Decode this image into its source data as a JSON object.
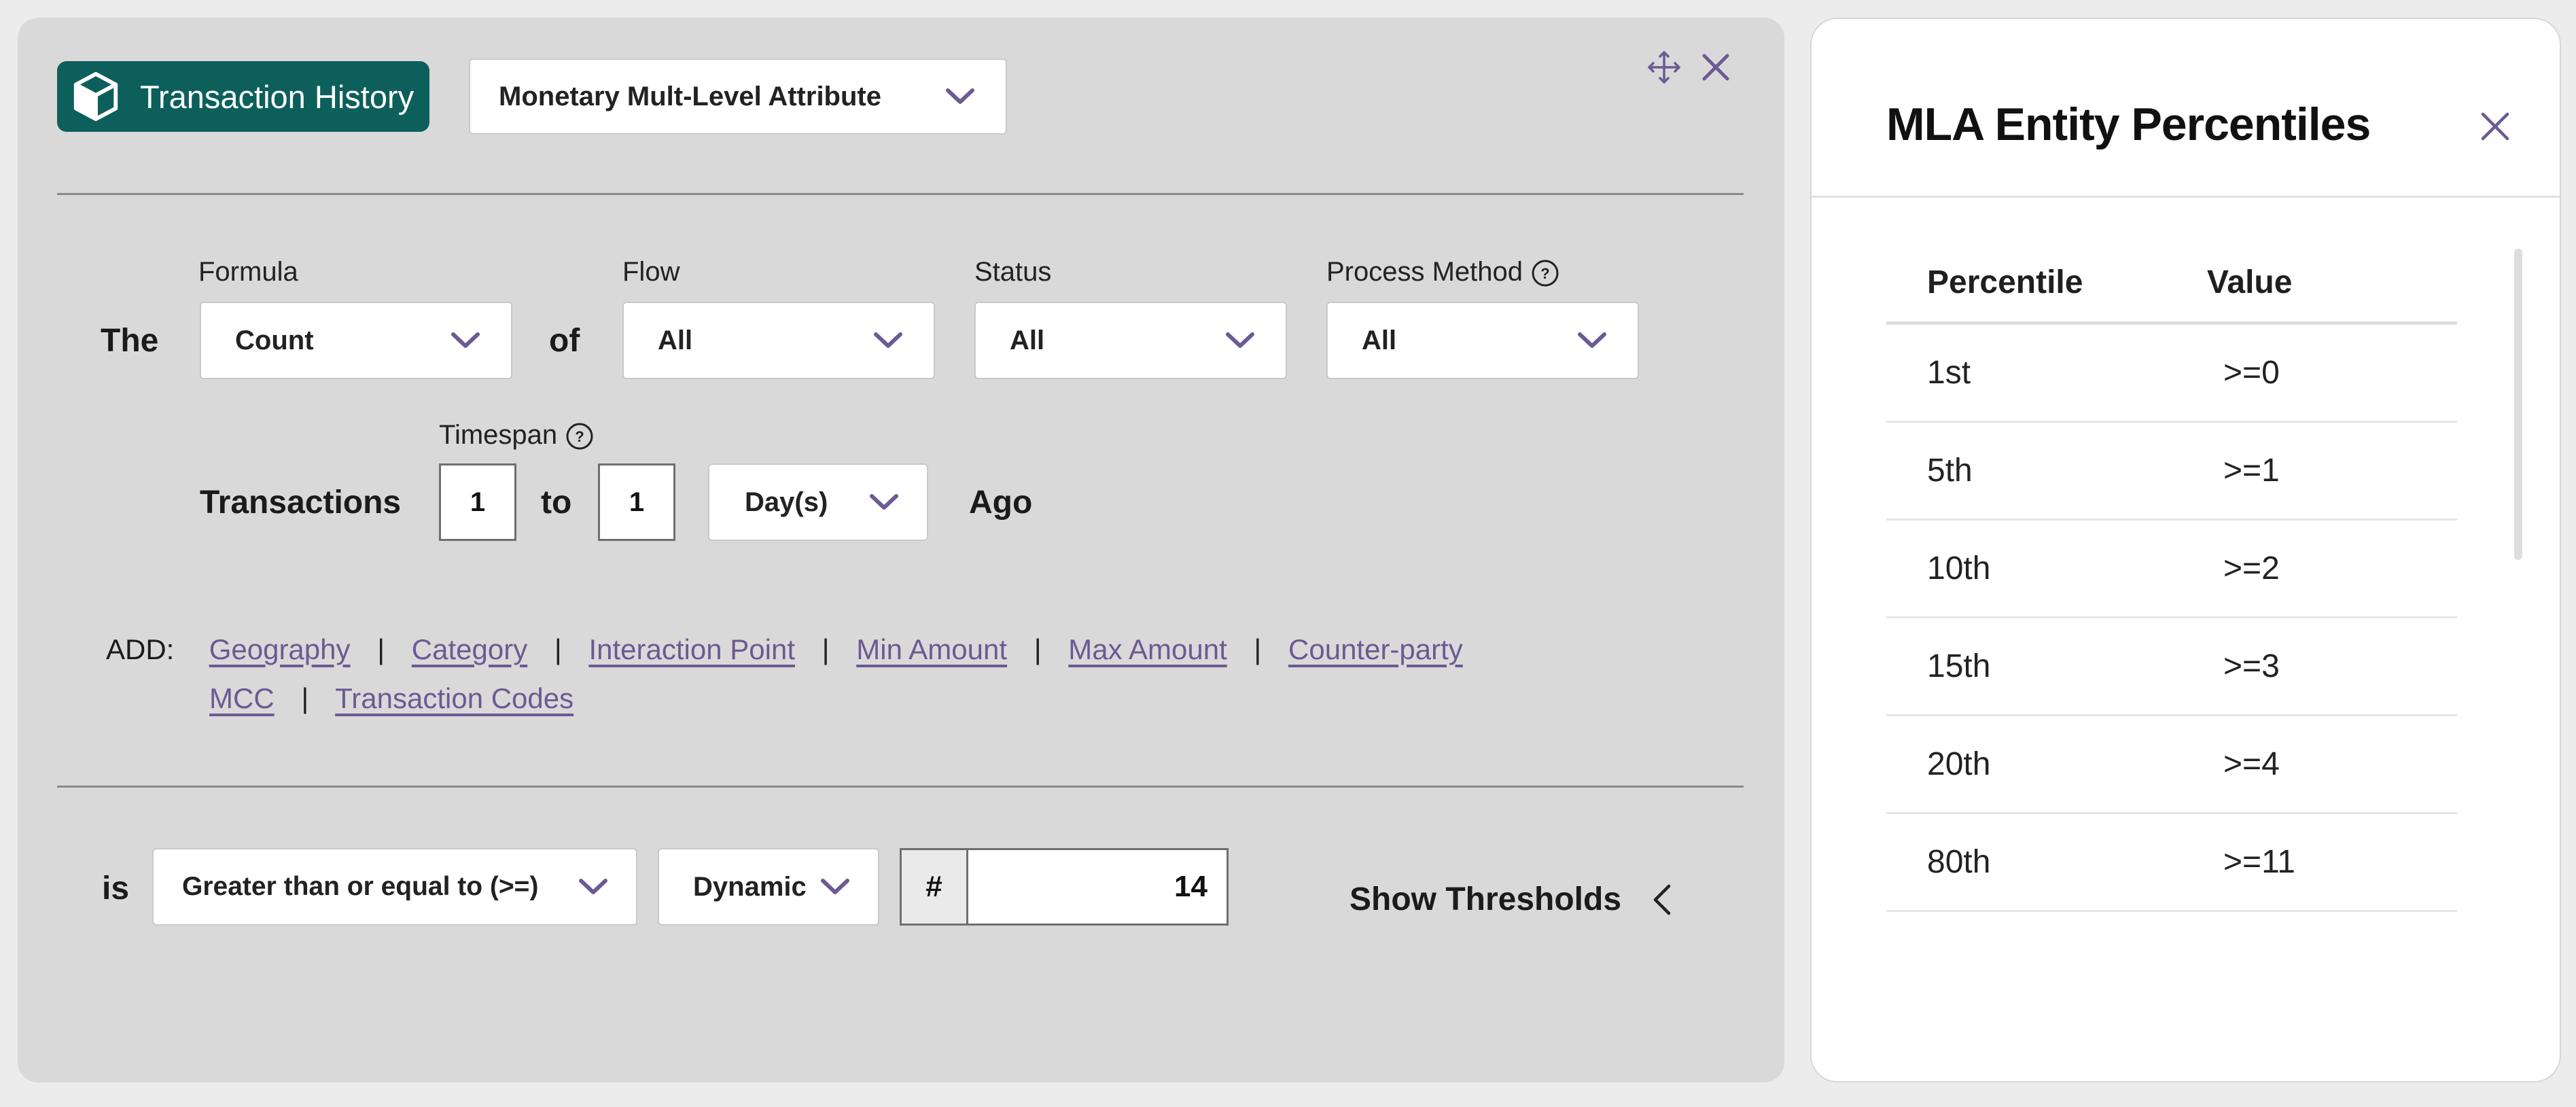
{
  "colors": {
    "accent": "#6b5a93",
    "brand_teal": "#0d5f5b",
    "panel_bg": "#d9d9d9"
  },
  "header": {
    "brand_label": "Transaction History",
    "attribute_select": "Monetary Mult-Level Attribute"
  },
  "formula_row": {
    "lead": "The",
    "formula": {
      "label": "Formula",
      "value": "Count"
    },
    "of": "of",
    "flow": {
      "label": "Flow",
      "value": "All"
    },
    "status": {
      "label": "Status",
      "value": "All"
    },
    "process_method": {
      "label": "Process Method",
      "value": "All"
    }
  },
  "timespan_row": {
    "lead": "Transactions",
    "label": "Timespan",
    "from": "1",
    "to_word": "to",
    "to": "1",
    "unit": "Day(s)",
    "tail": "Ago"
  },
  "add": {
    "label": "ADD:",
    "links": [
      "Geography",
      "Category",
      "Interaction Point",
      "Min Amount",
      "Max Amount",
      "Counter-party",
      "MCC",
      "Transaction Codes"
    ],
    "separator": "|"
  },
  "threshold_row": {
    "lead": "is",
    "operator": "Greater than or equal to (>=)",
    "mode": "Dynamic",
    "hash": "#",
    "value": "14",
    "show_thresholds": "Show Thresholds"
  },
  "side_panel": {
    "title": "MLA Entity Percentiles",
    "columns": [
      "Percentile",
      "Value"
    ],
    "rows": [
      [
        "1st",
        ">=0"
      ],
      [
        "5th",
        ">=1"
      ],
      [
        "10th",
        ">=2"
      ],
      [
        "15th",
        ">=3"
      ],
      [
        "20th",
        ">=4"
      ],
      [
        "80th",
        ">=11"
      ]
    ]
  }
}
